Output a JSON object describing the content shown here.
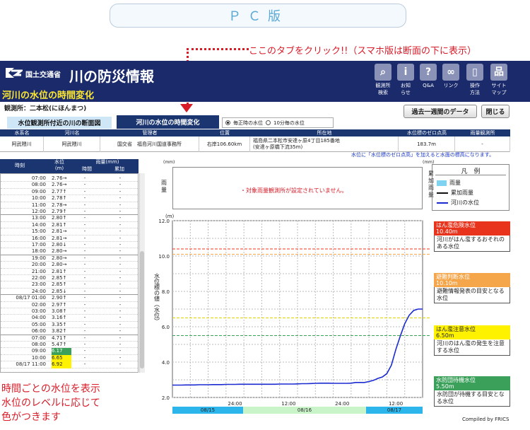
{
  "banner": {
    "pc_label": "ＰＣ版",
    "tab_hint": "ここのタブをクリック!!（スマホ版は断面の下に表示）"
  },
  "header": {
    "ministry": "国土交通省",
    "brand": "川の防災情報",
    "subtitle": "河川の水位の時間変化"
  },
  "nav": [
    {
      "label": "観測所\n検索",
      "icon": "search-icon",
      "glyph": "⌕"
    },
    {
      "label": "お知\nらせ",
      "icon": "info-icon",
      "glyph": "i"
    },
    {
      "label": "Q&A",
      "icon": "question-icon",
      "glyph": "?"
    },
    {
      "label": "リンク",
      "icon": "link-icon",
      "glyph": "∞"
    },
    {
      "label": "操作\n方法",
      "icon": "mouse-icon",
      "glyph": "▯"
    },
    {
      "label": "サイト\nマップ",
      "icon": "sitemap-icon",
      "glyph": "品"
    }
  ],
  "station": {
    "label": "観測所：二本松(にほんまつ)"
  },
  "buttons": {
    "week": "過去一週間のデータ",
    "close": "閉じる"
  },
  "tabs": {
    "cross_section": "水位観測所付近の川の断面図",
    "time_change": "河川の水位の時間変化"
  },
  "radios": {
    "hourly": "毎正時の水位",
    "ten_min": "10分毎の水位"
  },
  "info": {
    "headers": [
      "水系名",
      "河川名",
      "管理者",
      "位置",
      "所在地",
      "水位標のゼロ点高",
      "雨量観測所"
    ],
    "values": [
      "阿武隈川",
      "阿武隈川",
      "国交省　福島河川国道事務所",
      "右岸106.60km",
      "福島県二本松市安達ヶ原4丁目185番地\n(安達ヶ原橋下流35m)",
      "183.7m",
      "-"
    ],
    "note": "水位に「水位標のゼロ点高」を加えると水面の標高になります。"
  },
  "list": {
    "headers": {
      "time": "時刻",
      "level": "水位\n(m)",
      "rain": "雨量(mm)",
      "hourly": "時間",
      "cumulative": "累加"
    },
    "rows": [
      {
        "t": "07:00",
        "w": "2.76→",
        "r1": "-",
        "r2": "-"
      },
      {
        "t": "08:00",
        "w": "2.76→",
        "r1": "-",
        "r2": "-"
      },
      {
        "t": "09:00",
        "w": "2.77↑",
        "r1": "-",
        "r2": "-"
      },
      {
        "t": "10:00",
        "w": "2.78↑",
        "r1": "-",
        "r2": "-"
      },
      {
        "t": "11:00",
        "w": "2.78→",
        "r1": "-",
        "r2": "-"
      },
      {
        "t": "12:00",
        "w": "2.79↑",
        "r1": "-",
        "r2": "-"
      },
      {
        "t": "13:00",
        "w": "2.80↑",
        "r1": "-",
        "r2": "-"
      },
      {
        "t": "14:00",
        "w": "2.81↑",
        "r1": "-",
        "r2": "-"
      },
      {
        "t": "15:00",
        "w": "2.81→",
        "r1": "-",
        "r2": "-"
      },
      {
        "t": "16:00",
        "w": "2.81→",
        "r1": "-",
        "r2": "-"
      },
      {
        "t": "17:00",
        "w": "2.80↓",
        "r1": "-",
        "r2": "-"
      },
      {
        "t": "18:00",
        "w": "2.80→",
        "r1": "-",
        "r2": "-"
      },
      {
        "t": "19:00",
        "w": "2.80→",
        "r1": "-",
        "r2": "-"
      },
      {
        "t": "20:00",
        "w": "2.80→",
        "r1": "-",
        "r2": "-"
      },
      {
        "t": "21:00",
        "w": "2.81↑",
        "r1": "-",
        "r2": "-"
      },
      {
        "t": "22:00",
        "w": "2.85↑",
        "r1": "-",
        "r2": "-"
      },
      {
        "t": "23:00",
        "w": "2.85↑",
        "r1": "-",
        "r2": "-"
      },
      {
        "t": "24:00",
        "w": "2.85↓",
        "r1": "-",
        "r2": "-"
      },
      {
        "t": "08/17 01:00",
        "w": "2.90↑",
        "r1": "-",
        "r2": "-"
      },
      {
        "t": "02:00",
        "w": "2.97↑",
        "r1": "-",
        "r2": "-"
      },
      {
        "t": "03:00",
        "w": "3.08↑",
        "r1": "-",
        "r2": "-"
      },
      {
        "t": "04:00",
        "w": "3.16↑",
        "r1": "-",
        "r2": "-"
      },
      {
        "t": "05:00",
        "w": "3.35↑",
        "r1": "-",
        "r2": "-"
      },
      {
        "t": "06:00",
        "w": "3.82↑",
        "r1": "-",
        "r2": "-"
      },
      {
        "t": "07:00",
        "w": "4.71↑",
        "r1": "-",
        "r2": "-"
      },
      {
        "t": "08:00",
        "w": "5.47↑",
        "r1": "-",
        "r2": "-"
      },
      {
        "t": "09:00",
        "w": "6.17",
        "r1": "-",
        "r2": "-",
        "bg": "#3aa05a",
        "fg": "#fff"
      },
      {
        "t": "10:00",
        "w": "6.65",
        "r1": "-",
        "r2": "-",
        "bg": "#fff200",
        "fg": "#222"
      },
      {
        "t": "08/17 11:00",
        "w": "6.92",
        "r1": "-",
        "r2": "-",
        "bg": "#fff200",
        "fg": "#222"
      }
    ]
  },
  "caption": "時間ごとの水位を表示\n水位のレベルに応じて\n色がつきます",
  "rain_chart": {
    "unit": "(mm)",
    "y_label": "雨\n量",
    "cum_label": "累\n加\n雨\n量",
    "message": "・対象雨量観測所が設定されていません。"
  },
  "legend": {
    "title": "凡　例",
    "items": [
      {
        "label": "雨量",
        "color": "#7fd3f0"
      },
      {
        "label": "累加雨量",
        "color": "#111111"
      },
      {
        "label": "河川の水位",
        "color": "#1a2ad0"
      }
    ]
  },
  "levels": [
    {
      "name": "はん濫危険水位",
      "value": "10.40m",
      "desc": "河川がはん濫するおそれのある水位",
      "color": "#e8341c"
    },
    {
      "name": "避難判断水位",
      "value": "10.10m",
      "desc": "避難情報発表の目安となる水位",
      "color": "#f5a54a"
    },
    {
      "name": "はん濫注意水位",
      "value": "6.50m",
      "desc": "河川のはん濫の発生を注意する水位",
      "color": "#fff200",
      "fg": "#222"
    },
    {
      "name": "水防団待機水位",
      "value": "5.50m",
      "desc": "水防団が待機する目安となる水位",
      "color": "#3aa05a"
    }
  ],
  "chart_data": {
    "type": "line",
    "unit": "(m)",
    "ylabel": "水位標の値（水位）",
    "ylim": [
      2.0,
      12.0
    ],
    "yticks": [
      "2.0",
      "4.0",
      "6.0",
      "8.0",
      "10.0",
      "12.0"
    ],
    "xticks": [
      "24:00",
      "12:00",
      "24:00",
      "12:00"
    ],
    "dates": [
      {
        "label": "08/15",
        "color": "#2bb5ea"
      },
      {
        "label": "08/16",
        "color": "#c9f3c9"
      },
      {
        "label": "08/17",
        "color": "#2bb5ea"
      }
    ],
    "thresholds": [
      {
        "value": 10.4,
        "color": "#e8341c"
      },
      {
        "value": 10.1,
        "color": "#f5a54a"
      },
      {
        "value": 6.5,
        "color": "#e0d400"
      },
      {
        "value": 5.5,
        "color": "#3aa05a"
      }
    ],
    "series": [
      {
        "color": "#1a2ad0",
        "x": [
          0,
          1,
          2,
          3,
          4,
          5,
          6,
          7,
          8,
          9,
          10,
          11,
          12,
          13,
          14,
          15,
          16,
          17,
          18,
          19,
          20,
          21,
          22,
          23,
          24,
          25,
          26,
          27,
          28,
          29,
          30,
          31,
          32,
          33,
          34,
          35,
          36,
          37,
          38,
          39,
          40,
          41,
          42,
          43,
          44,
          45,
          46,
          47,
          48,
          49,
          50,
          51,
          52,
          53,
          54,
          55,
          56
        ],
        "y": [
          2.7,
          2.7,
          2.7,
          2.71,
          2.71,
          2.71,
          2.72,
          2.72,
          2.72,
          2.73,
          2.73,
          2.73,
          2.74,
          2.74,
          2.74,
          2.75,
          2.75,
          2.75,
          2.75,
          2.75,
          2.75,
          2.75,
          2.75,
          2.75,
          2.76,
          2.76,
          2.76,
          2.76,
          2.77,
          2.78,
          2.78,
          2.79,
          2.8,
          2.81,
          2.81,
          2.81,
          2.8,
          2.8,
          2.8,
          2.8,
          2.81,
          2.85,
          2.85,
          2.85,
          2.9,
          2.97,
          3.08,
          3.16,
          3.35,
          3.82,
          4.71,
          5.47,
          6.17,
          6.65,
          6.92,
          7.0,
          7.0
        ]
      }
    ]
  }
}
